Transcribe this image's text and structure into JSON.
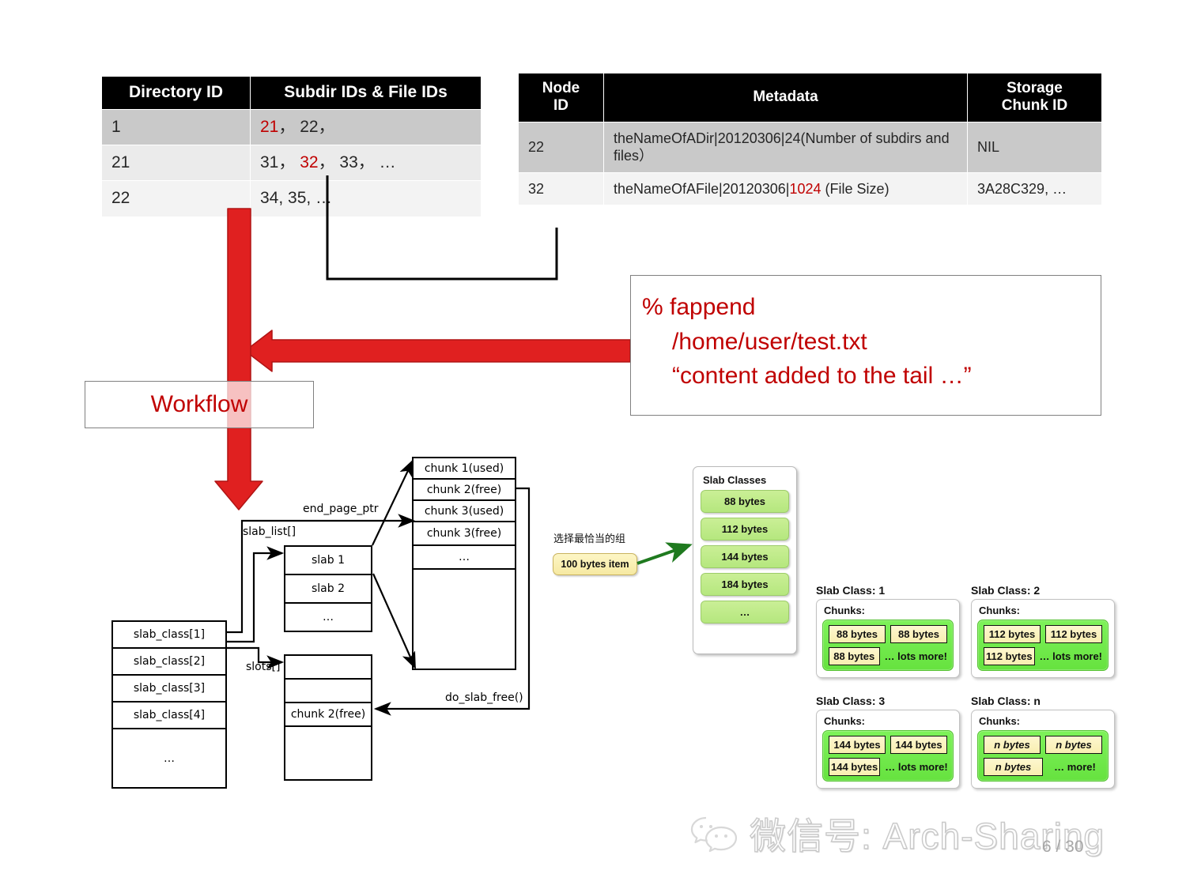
{
  "dir_table": {
    "headers": [
      "Directory  ID",
      "Subdir IDs & File IDs"
    ],
    "rows": [
      {
        "id": "1",
        "id_red": true,
        "entries": "21，  22，"
      },
      {
        "id": "21",
        "id_red": true,
        "entries": "31，  32，  33，  …"
      },
      {
        "id": "22",
        "id_red": false,
        "entries": "34,  35,   …"
      }
    ]
  },
  "node_table": {
    "headers": [
      "Node ID",
      "Metadata",
      "Storage Chunk ID"
    ],
    "header_node_line1": "Node",
    "header_node_line2": "ID",
    "header_metadata": "Metadata",
    "header_chunk_line1": "Storage",
    "header_chunk_line2": "Chunk ID",
    "rows": [
      {
        "node_id": "22",
        "node_id_red": false,
        "metadata": "theNameOfADir|20120306|24(Number of subdirs and files）",
        "chunk_id": "NIL",
        "chunk_id_red": false
      },
      {
        "node_id": "32",
        "node_id_red": true,
        "metadata_pre": "theNameOfAFile|20120306|",
        "metadata_highlight": "1024",
        "metadata_post": " (File Size)",
        "chunk_id": "3A28C329, …",
        "chunk_id_red": true
      }
    ]
  },
  "workflow": {
    "label": "Workflow"
  },
  "command": {
    "line1": "% fappend",
    "line2": "/home/user/test.txt",
    "line3": "“content  added to the tail …”"
  },
  "slab_diagram": {
    "slab_class_array": [
      "slab_class[1]",
      "slab_class[2]",
      "slab_class[3]",
      "slab_class[4]",
      "…"
    ],
    "slab_list_label": "slab_list[]",
    "slots_label": "slots[]",
    "end_page_ptr_label": "end_page_ptr",
    "do_slab_free_label": "do_slab_free()",
    "slab_list_box": [
      "slab 1",
      "slab 2",
      "…"
    ],
    "chunk_list_box": [
      "chunk 1(used)",
      "chunk 2(free)",
      "chunk 3(used)",
      "chunk 3(free)",
      "…"
    ],
    "slots_box": [
      "",
      "",
      "chunk 2(free)",
      ""
    ]
  },
  "picker": {
    "caption": "选择最恰当的组",
    "item_label": "100 bytes item"
  },
  "slab_classes_panel": {
    "title": "Slab Classes",
    "items": [
      "88 bytes",
      "112 bytes",
      "144 bytes",
      "184 bytes",
      "…"
    ]
  },
  "slab_class_cards": [
    {
      "title": "Slab Class: 1",
      "chunks_label": "Chunks:",
      "chips": [
        "88 bytes",
        "88 bytes",
        "88 bytes"
      ],
      "more": "… lots more!",
      "italic_unit": false
    },
    {
      "title": "Slab Class: 2",
      "chunks_label": "Chunks:",
      "chips": [
        "112 bytes",
        "112 bytes",
        "112 bytes"
      ],
      "more": "… lots more!",
      "italic_unit": false
    },
    {
      "title": "Slab Class: 3",
      "chunks_label": "Chunks:",
      "chips": [
        "144 bytes",
        "144 bytes",
        "144 bytes"
      ],
      "more": "… lots more!",
      "italic_unit": false
    },
    {
      "title": "Slab Class: n",
      "chunks_label": "Chunks:",
      "chips": [
        "n bytes",
        "n bytes",
        "n bytes"
      ],
      "more": "… more!",
      "italic_unit": true
    }
  ],
  "footer": {
    "watermark_text": "微信号: Arch-Sharing",
    "page_number": "6 / 30"
  },
  "colors": {
    "accent_red": "#c00000",
    "arrow_red": "#e02020",
    "header_black": "#000000",
    "green_arrow": "#1f7a1f"
  }
}
